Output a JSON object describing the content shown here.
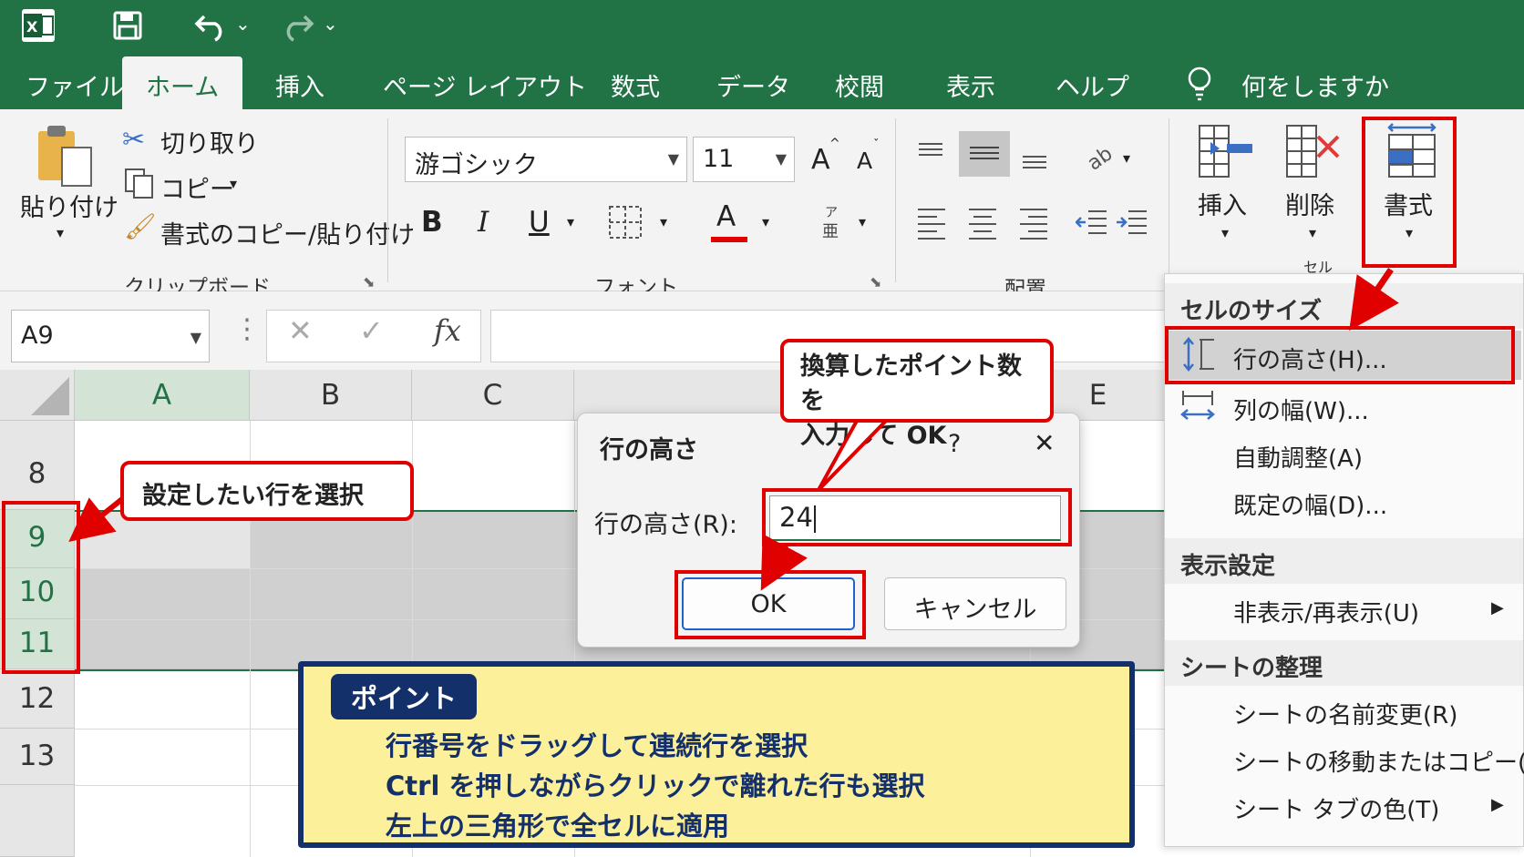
{
  "quick_access": {
    "undo_caret": "⌄",
    "redo_caret": "⌄"
  },
  "tabs": [
    "ファイル",
    "ホーム",
    "挿入",
    "ページ レイアウト",
    "数式",
    "データ",
    "校閲",
    "表示",
    "ヘルプ"
  ],
  "tell_me": "何をしますか",
  "clipboard": {
    "paste": "貼り付け",
    "cut": "切り取り",
    "copy": "コピー",
    "format_painter": "書式のコピー/貼り付け",
    "group": "クリップボード"
  },
  "font": {
    "name": "游ゴシック",
    "size": "11",
    "bold": "B",
    "italic": "I",
    "underline": "U",
    "font_color": "A",
    "grow": "A",
    "shrink": "A",
    "group": "フォント"
  },
  "alignment": {
    "group": "配置"
  },
  "cells": {
    "insert": "挿入",
    "delete": "削除",
    "format": "書式",
    "group": "セル"
  },
  "formula_bar": {
    "name_box": "A9",
    "fx": "fx"
  },
  "columns": [
    "A",
    "B",
    "C",
    "E"
  ],
  "rows": [
    "8",
    "9",
    "10",
    "11",
    "12",
    "13"
  ],
  "dialog": {
    "title": "行の高さ",
    "help": "?",
    "close": "✕",
    "field_label": "行の高さ(R):",
    "value": "24",
    "ok": "OK",
    "cancel": "キャンセル"
  },
  "format_menu": {
    "cell_size_header": "セルのサイズ",
    "row_height": "行の高さ(H)...",
    "column_width": "列の幅(W)...",
    "autofit": "自動調整(A)",
    "default_width": "既定の幅(D)...",
    "visibility_header": "表示設定",
    "hide_unhide": "非表示/再表示(U)",
    "organize_header": "シートの整理",
    "rename": "シートの名前変更(R)",
    "move_copy": "シートの移動またはコピー(M)...",
    "tab_color": "シート タブの色(T)"
  },
  "callouts": {
    "select_rows": "設定したい行を選択",
    "enter_points_1": "換算したポイント数を",
    "enter_points_2": "入力して OK"
  },
  "tip": {
    "label": "ポイント",
    "lines": [
      "行番号をドラッグして連続行を選択",
      "Ctrl を押しながらクリックで離れた行も選択",
      "左上の三角形で全セルに適用"
    ]
  },
  "colors": {
    "excel_green": "#217346",
    "highlight_red": "#e10000",
    "tip_navy": "#14306b",
    "tip_yellow": "#fdf09a"
  }
}
